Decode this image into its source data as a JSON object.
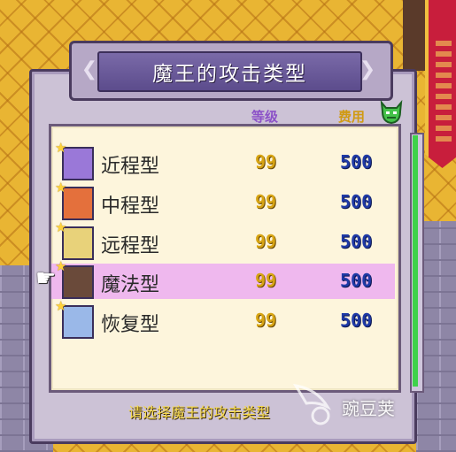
{
  "dialog": {
    "title": "魔王的攻击类型",
    "columns": {
      "level": "等级",
      "cost": "费用"
    },
    "cost_icon": "green-demon-icon",
    "rows": [
      {
        "label": "近程型",
        "level": "99",
        "cost": "500",
        "avatar": "purple-demon-portrait",
        "selected": false
      },
      {
        "label": "中程型",
        "level": "99",
        "cost": "500",
        "avatar": "red-hair-portrait",
        "selected": false
      },
      {
        "label": "远程型",
        "level": "99",
        "cost": "500",
        "avatar": "blonde-archer-portrait",
        "selected": false
      },
      {
        "label": "魔法型",
        "level": "99",
        "cost": "500",
        "avatar": "dark-mage-portrait",
        "selected": true
      },
      {
        "label": "恢复型",
        "level": "99",
        "cost": "500",
        "avatar": "blue-healer-portrait",
        "selected": false
      }
    ],
    "prompt": "请选择魔王的攻击类型"
  },
  "watermark": {
    "text": "豌豆荚"
  },
  "colors": {
    "title_bar": "#5c4c8c",
    "selected_row": "#efb8ee",
    "level_text": "#d7a413",
    "cost_text": "#1f3aa6",
    "scroll_thumb": "#3fd24a",
    "prompt_text": "#f5d84a"
  }
}
